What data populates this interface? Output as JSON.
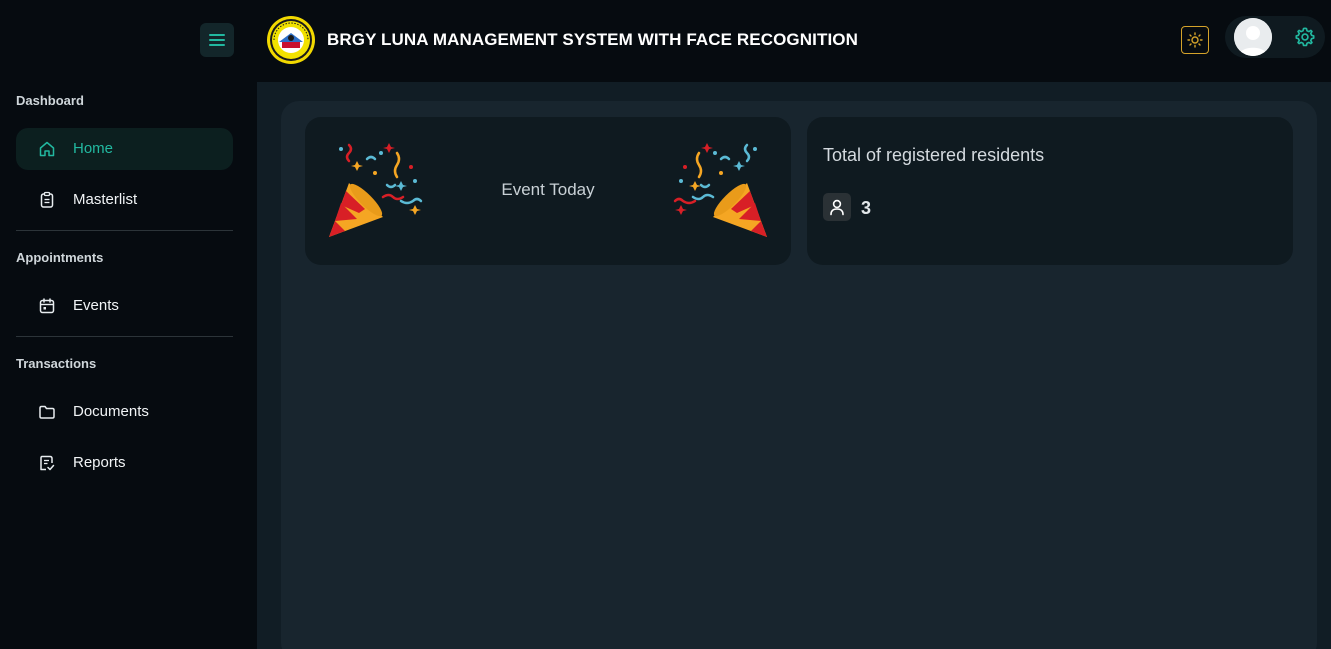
{
  "header": {
    "title": "BRGY LUNA MANAGEMENT SYSTEM WITH FACE RECOGNITION",
    "logo_icon": "barangay-seal-logo",
    "menu_icon": "hamburger-menu-icon",
    "theme_icon": "sun-icon",
    "settings_icon": "gear-icon",
    "accent_color": "#22b8a0",
    "theme_accent": "#d4a32a"
  },
  "sidebar": {
    "sections": [
      {
        "title": "Dashboard",
        "items": [
          {
            "label": "Home",
            "icon": "home-icon",
            "active": true
          },
          {
            "label": "Masterlist",
            "icon": "clipboard-icon",
            "active": false
          }
        ]
      },
      {
        "title": "Appointments",
        "items": [
          {
            "label": "Events",
            "icon": "calendar-icon",
            "active": false
          }
        ]
      },
      {
        "title": "Transactions",
        "items": [
          {
            "label": "Documents",
            "icon": "folder-icon",
            "active": false
          },
          {
            "label": "Reports",
            "icon": "report-icon",
            "active": false
          }
        ]
      }
    ]
  },
  "dashboard": {
    "event_card": {
      "title": "Event Today",
      "icon": "party-popper-icon"
    },
    "residents_card": {
      "title": "Total of registered residents",
      "count": "3",
      "icon": "user-icon"
    }
  }
}
